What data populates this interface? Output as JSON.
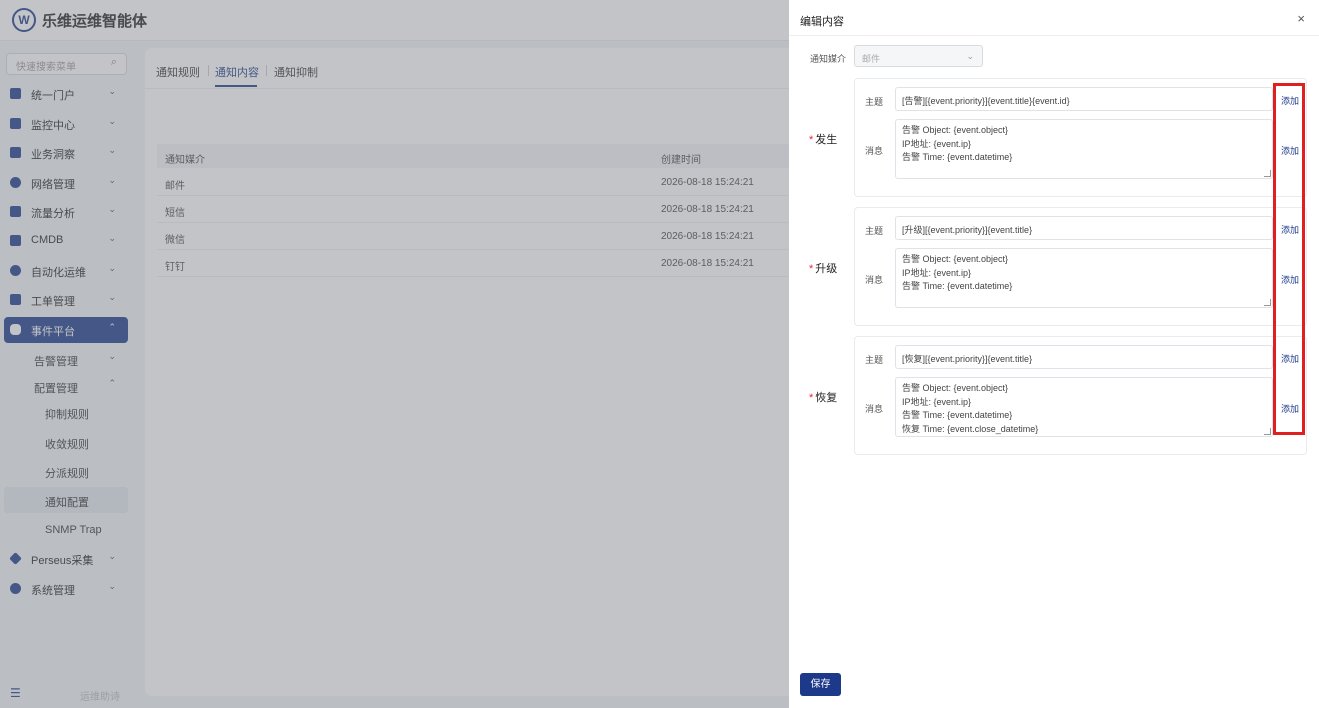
{
  "app": {
    "title": "乐维运维智能体",
    "logo": "W"
  },
  "sidebar": {
    "search_placeholder": "快速搜索菜单",
    "items": [
      {
        "label": "统一门户",
        "icon": "home-icon"
      },
      {
        "label": "监控中心",
        "icon": "monitor-icon"
      },
      {
        "label": "业务洞察",
        "icon": "insight-icon"
      },
      {
        "label": "网络管理",
        "icon": "globe-icon"
      },
      {
        "label": "流量分析",
        "icon": "traffic-icon"
      },
      {
        "label": "CMDB",
        "icon": "cube-icon"
      },
      {
        "label": "自动化运维",
        "icon": "gear-icon"
      },
      {
        "label": "工单管理",
        "icon": "ticket-icon"
      },
      {
        "label": "事件平台",
        "icon": "bell-icon"
      }
    ],
    "sub_items": {
      "alarm": "告警管理",
      "config": "配置管理",
      "suppress": "抑制规则",
      "converge": "收敛规则",
      "dispatch": "分派规则",
      "notify": "通知配置",
      "snmp": "SNMP Trap"
    },
    "bottom_items": [
      {
        "label": "Perseus采集",
        "icon": "diamond-icon"
      },
      {
        "label": "系统管理",
        "icon": "settings-icon"
      }
    ],
    "footer": "运维助诗"
  },
  "main": {
    "tabs": [
      "通知规则",
      "通知内容",
      "通知抑制"
    ],
    "table": {
      "headers": [
        "通知媒介",
        "创建时间"
      ],
      "rows": [
        [
          "邮件",
          "2026-08-18 15:24:21"
        ],
        [
          "短信",
          "2026-08-18 15:24:21"
        ],
        [
          "微信",
          "2026-08-18 15:24:21"
        ],
        [
          "钉钉",
          "2026-08-18 15:24:21"
        ]
      ]
    }
  },
  "drawer": {
    "title": "编辑内容",
    "close": "×",
    "media_label": "通知媒介",
    "media_value": "邮件",
    "subject_label": "主题",
    "message_label": "消息",
    "add_label": "添加",
    "sections": [
      {
        "label": "发生",
        "subject": "[告警][{event.priority}]{event.title}{event.id}",
        "message": [
          "告警 Object: {event.object}",
          "IP地址: {event.ip}",
          "告警 Time: {event.datetime}"
        ]
      },
      {
        "label": "升级",
        "subject": "[升级][{event.priority}]{event.title}",
        "message": [
          "告警 Object: {event.object}",
          "IP地址: {event.ip}",
          "告警 Time: {event.datetime}"
        ]
      },
      {
        "label": "恢复",
        "subject": "[恢复][{event.priority}]{event.title}",
        "message": [
          "告警 Object: {event.object}",
          "IP地址: {event.ip}",
          "告警 Time: {event.datetime}",
          "恢复 Time: {event.close_datetime}"
        ]
      }
    ],
    "save_label": "保存"
  },
  "colors": {
    "primary": "#1d3a8a",
    "highlight": "#e02020",
    "required": "#e22233"
  }
}
